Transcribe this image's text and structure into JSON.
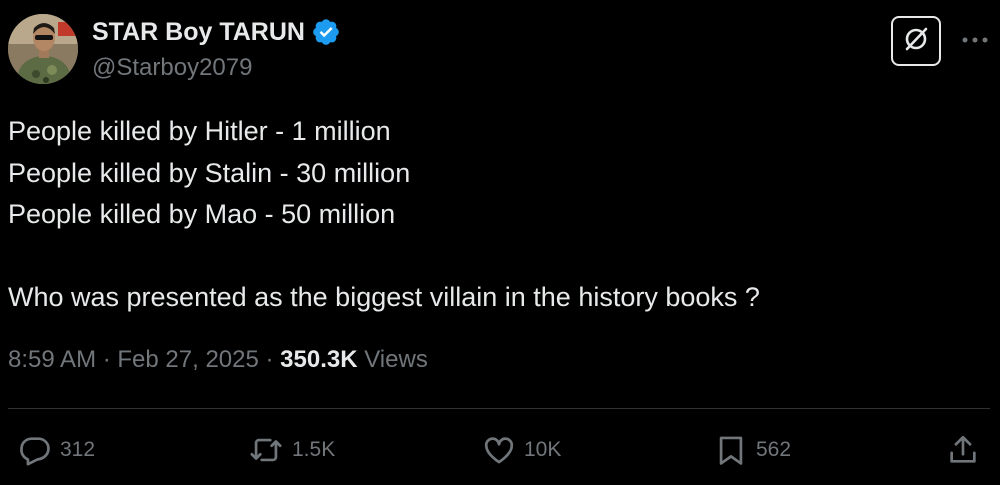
{
  "author": {
    "display_name": "STAR Boy TARUN",
    "handle": "@Starboy2079",
    "verified": true
  },
  "tweet": {
    "lines": [
      "People killed by Hitler - 1 million",
      "People killed by Stalin - 30 million",
      "People killed by Mao - 50 million",
      "",
      "Who was presented as the biggest villain in the history books ?"
    ]
  },
  "meta": {
    "time": "8:59 AM",
    "separator": " · ",
    "date": "Feb 27, 2025",
    "views_count": "350.3K",
    "views_label": " Views"
  },
  "actions": {
    "replies": "312",
    "reposts": "1.5K",
    "likes": "10K",
    "bookmarks": "562"
  },
  "colors": {
    "background": "#000000",
    "text": "#e7e9ea",
    "muted": "#71767b",
    "verified": "#1d9bf0",
    "divider": "#2f3336"
  },
  "icons": {
    "verified": "verified-badge-icon",
    "grok": "grok-icon",
    "more": "more-icon",
    "reply": "reply-icon",
    "repost": "repost-icon",
    "like": "like-icon",
    "bookmark": "bookmark-icon",
    "share": "share-icon"
  }
}
